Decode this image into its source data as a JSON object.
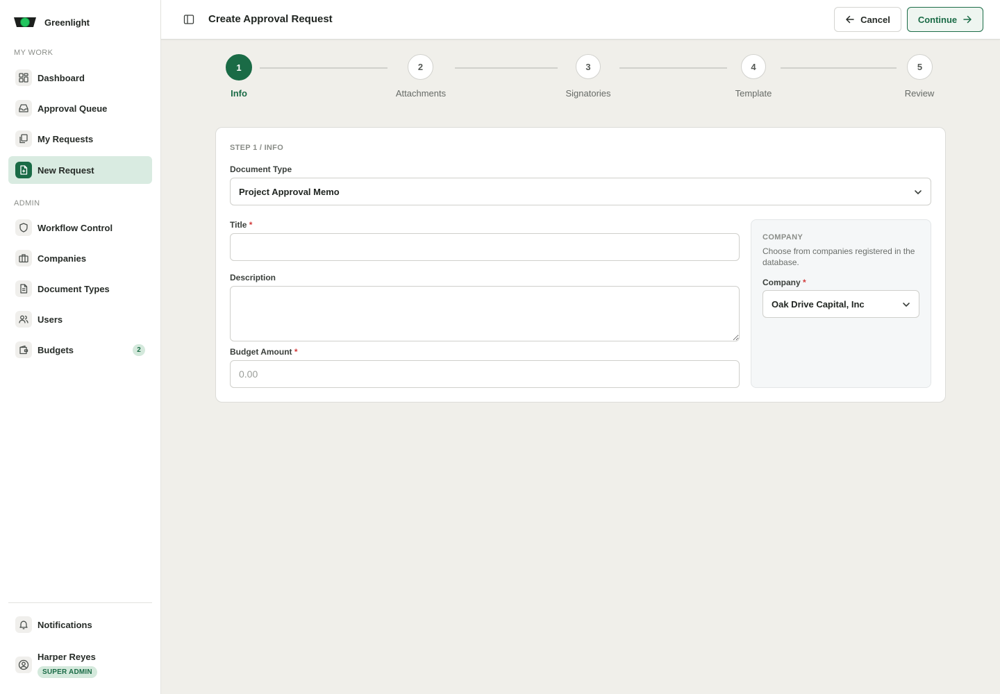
{
  "app": {
    "name": "Greenlight"
  },
  "sidebar": {
    "sections": {
      "my_work": "MY WORK",
      "admin": "ADMIN"
    },
    "my_work_items": [
      {
        "label": "Dashboard",
        "icon": "dashboard-icon"
      },
      {
        "label": "Approval Queue",
        "icon": "inbox-icon"
      },
      {
        "label": "My Requests",
        "icon": "copy-icon"
      },
      {
        "label": "New Request",
        "icon": "file-plus-icon",
        "active": true
      }
    ],
    "admin_items": [
      {
        "label": "Workflow Control",
        "icon": "shield-icon"
      },
      {
        "label": "Companies",
        "icon": "briefcase-icon"
      },
      {
        "label": "Document Types",
        "icon": "document-icon"
      },
      {
        "label": "Users",
        "icon": "users-icon"
      },
      {
        "label": "Budgets",
        "icon": "wallet-icon",
        "badge": "2"
      }
    ],
    "notifications": {
      "label": "Notifications",
      "icon": "bell-icon"
    },
    "user": {
      "name": "Harper Reyes",
      "role": "SUPER ADMIN",
      "icon": "user-circle-icon"
    }
  },
  "header": {
    "title": "Create Approval Request",
    "cancel_label": "Cancel",
    "continue_label": "Continue"
  },
  "stepper": {
    "steps": [
      {
        "number": "1",
        "label": "Info",
        "active": true
      },
      {
        "number": "2",
        "label": "Attachments"
      },
      {
        "number": "3",
        "label": "Signatories"
      },
      {
        "number": "4",
        "label": "Template"
      },
      {
        "number": "5",
        "label": "Review"
      }
    ]
  },
  "form": {
    "eyebrow": "STEP 1 / INFO",
    "document_type": {
      "label": "Document Type",
      "value": "Project Approval Memo"
    },
    "title": {
      "label": "Title",
      "required_mark": "*",
      "value": ""
    },
    "description": {
      "label": "Description",
      "value": ""
    },
    "budget": {
      "label": "Budget Amount",
      "required_mark": "*",
      "placeholder": "0.00"
    },
    "company_panel": {
      "eyebrow": "COMPANY",
      "description": "Choose from companies registered in the database.",
      "label": "Company",
      "required_mark": "*",
      "value": "Oak Drive Capital, Inc"
    }
  },
  "colors": {
    "accent": "#1a6b46",
    "accent_light": "#d9ebe1",
    "required": "#d23b3b",
    "background": "#f0efea"
  }
}
